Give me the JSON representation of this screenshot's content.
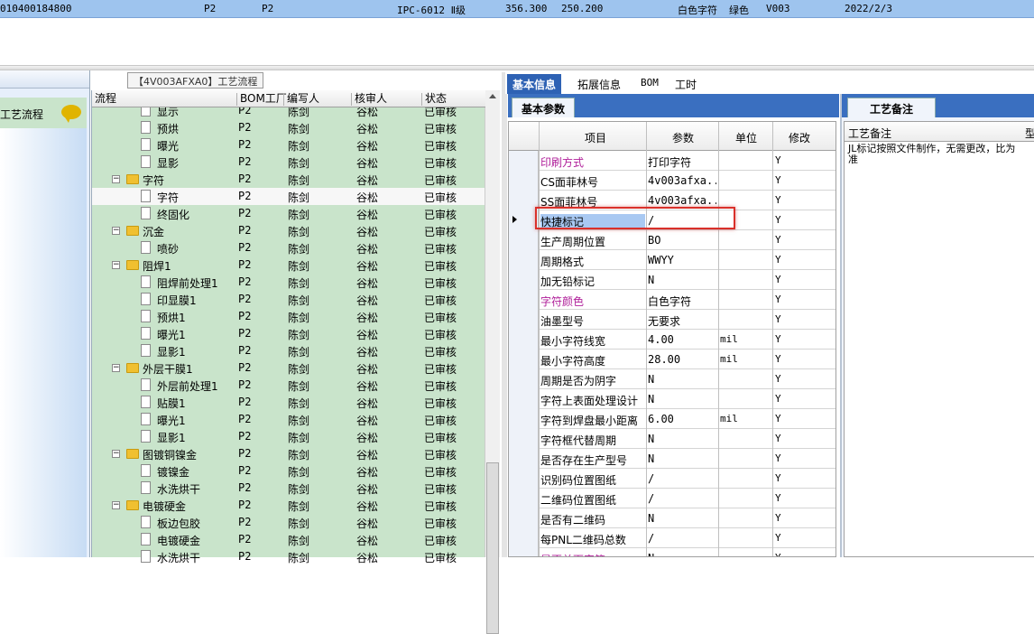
{
  "top_row": {
    "code": "010400184800",
    "col_p2_a": "P2",
    "col_p2_b": "P2",
    "grade": "IPC-6012 Ⅱ级",
    "dim_a": "356.300",
    "dim_b": "250.200",
    "legend_color": "白色字符",
    "mask_color": "绿色",
    "version": "V003",
    "date": "2022/2/3"
  },
  "left_panel": {
    "item_label": "工艺流程"
  },
  "process": {
    "title": "【4V003AFXA0】工艺流程"
  },
  "tree": {
    "columns": [
      "流程",
      "BOM工厂",
      "编写人",
      "核审人",
      "状态"
    ],
    "rows": [
      {
        "name": "显示",
        "level": 2,
        "type": "doc",
        "bom": "P2",
        "writer": "陈剑",
        "reviewer": "谷松",
        "status": "已审核"
      },
      {
        "name": "预烘",
        "level": 2,
        "type": "doc",
        "bom": "P2",
        "writer": "陈剑",
        "reviewer": "谷松",
        "status": "已审核"
      },
      {
        "name": "曝光",
        "level": 2,
        "type": "doc",
        "bom": "P2",
        "writer": "陈剑",
        "reviewer": "谷松",
        "status": "已审核"
      },
      {
        "name": "显影",
        "level": 2,
        "type": "doc",
        "bom": "P2",
        "writer": "陈剑",
        "reviewer": "谷松",
        "status": "已审核"
      },
      {
        "name": "字符",
        "level": 1,
        "type": "folder",
        "bom": "P2",
        "writer": "陈剑",
        "reviewer": "谷松",
        "status": "已审核"
      },
      {
        "name": "字符",
        "level": 2,
        "type": "doc",
        "bom": "P2",
        "writer": "陈剑",
        "reviewer": "谷松",
        "status": "已审核",
        "selected": true
      },
      {
        "name": "终固化",
        "level": 2,
        "type": "doc",
        "bom": "P2",
        "writer": "陈剑",
        "reviewer": "谷松",
        "status": "已审核"
      },
      {
        "name": "沉金",
        "level": 1,
        "type": "folder",
        "bom": "P2",
        "writer": "陈剑",
        "reviewer": "谷松",
        "status": "已审核"
      },
      {
        "name": "喷砂",
        "level": 2,
        "type": "doc",
        "bom": "P2",
        "writer": "陈剑",
        "reviewer": "谷松",
        "status": "已审核"
      },
      {
        "name": "阻焊1",
        "level": 1,
        "type": "folder",
        "bom": "P2",
        "writer": "陈剑",
        "reviewer": "谷松",
        "status": "已审核"
      },
      {
        "name": "阻焊前处理1",
        "level": 2,
        "type": "doc",
        "bom": "P2",
        "writer": "陈剑",
        "reviewer": "谷松",
        "status": "已审核"
      },
      {
        "name": "印显膜1",
        "level": 2,
        "type": "doc",
        "bom": "P2",
        "writer": "陈剑",
        "reviewer": "谷松",
        "status": "已审核"
      },
      {
        "name": "预烘1",
        "level": 2,
        "type": "doc",
        "bom": "P2",
        "writer": "陈剑",
        "reviewer": "谷松",
        "status": "已审核"
      },
      {
        "name": "曝光1",
        "level": 2,
        "type": "doc",
        "bom": "P2",
        "writer": "陈剑",
        "reviewer": "谷松",
        "status": "已审核"
      },
      {
        "name": "显影1",
        "level": 2,
        "type": "doc",
        "bom": "P2",
        "writer": "陈剑",
        "reviewer": "谷松",
        "status": "已审核"
      },
      {
        "name": "外层干膜1",
        "level": 1,
        "type": "folder",
        "bom": "P2",
        "writer": "陈剑",
        "reviewer": "谷松",
        "status": "已审核"
      },
      {
        "name": "外层前处理1",
        "level": 2,
        "type": "doc",
        "bom": "P2",
        "writer": "陈剑",
        "reviewer": "谷松",
        "status": "已审核"
      },
      {
        "name": "贴膜1",
        "level": 2,
        "type": "doc",
        "bom": "P2",
        "writer": "陈剑",
        "reviewer": "谷松",
        "status": "已审核"
      },
      {
        "name": "曝光1",
        "level": 2,
        "type": "doc",
        "bom": "P2",
        "writer": "陈剑",
        "reviewer": "谷松",
        "status": "已审核"
      },
      {
        "name": "显影1",
        "level": 2,
        "type": "doc",
        "bom": "P2",
        "writer": "陈剑",
        "reviewer": "谷松",
        "status": "已审核"
      },
      {
        "name": "图镀铜镍金",
        "level": 1,
        "type": "folder",
        "bom": "P2",
        "writer": "陈剑",
        "reviewer": "谷松",
        "status": "已审核"
      },
      {
        "name": "镀镍金",
        "level": 2,
        "type": "doc",
        "bom": "P2",
        "writer": "陈剑",
        "reviewer": "谷松",
        "status": "已审核"
      },
      {
        "name": "水洗烘干",
        "level": 2,
        "type": "doc",
        "bom": "P2",
        "writer": "陈剑",
        "reviewer": "谷松",
        "status": "已审核"
      },
      {
        "name": "电镀硬金",
        "level": 1,
        "type": "folder",
        "bom": "P2",
        "writer": "陈剑",
        "reviewer": "谷松",
        "status": "已审核"
      },
      {
        "name": "板边包胶",
        "level": 2,
        "type": "doc",
        "bom": "P2",
        "writer": "陈剑",
        "reviewer": "谷松",
        "status": "已审核"
      },
      {
        "name": "电镀硬金",
        "level": 2,
        "type": "doc",
        "bom": "P2",
        "writer": "陈剑",
        "reviewer": "谷松",
        "status": "已审核"
      },
      {
        "name": "水洗烘干",
        "level": 2,
        "type": "doc",
        "bom": "P2",
        "writer": "陈剑",
        "reviewer": "谷松",
        "status": "已审核"
      }
    ]
  },
  "tabs": {
    "items": [
      "基本信息",
      "拓展信息",
      "BOM",
      "工时"
    ],
    "active": 0,
    "sub_tab": "基本参数"
  },
  "params": {
    "columns": [
      "项目",
      "参数",
      "单位",
      "修改"
    ],
    "rows": [
      {
        "name": "印刷方式",
        "value": "打印字符",
        "unit": "",
        "mod": "Y",
        "pink": true
      },
      {
        "name": "CS面菲林号",
        "value": "4v003afxa...",
        "unit": "",
        "mod": "Y"
      },
      {
        "name": "SS面菲林号",
        "value": "4v003afxa...",
        "unit": "",
        "mod": "Y"
      },
      {
        "name": "快捷标记",
        "value": "/",
        "unit": "",
        "mod": "Y",
        "current": true
      },
      {
        "name": "生产周期位置",
        "value": "BO",
        "unit": "",
        "mod": "Y"
      },
      {
        "name": "周期格式",
        "value": "WWYY",
        "unit": "",
        "mod": "Y"
      },
      {
        "name": "加无铅标记",
        "value": "N",
        "unit": "",
        "mod": "Y"
      },
      {
        "name": "字符颜色",
        "value": "白色字符",
        "unit": "",
        "mod": "Y",
        "pink": true
      },
      {
        "name": "油墨型号",
        "value": "无要求",
        "unit": "",
        "mod": "Y"
      },
      {
        "name": "最小字符线宽",
        "value": "4.00",
        "unit": "mil",
        "mod": "Y"
      },
      {
        "name": "最小字符高度",
        "value": "28.00",
        "unit": "mil",
        "mod": "Y"
      },
      {
        "name": "周期是否为阴字",
        "value": "N",
        "unit": "",
        "mod": "Y"
      },
      {
        "name": "字符上表面处理设计",
        "value": "N",
        "unit": "",
        "mod": "Y"
      },
      {
        "name": "字符到焊盘最小距离",
        "value": "6.00",
        "unit": "mil",
        "mod": "Y"
      },
      {
        "name": "字符框代替周期",
        "value": "N",
        "unit": "",
        "mod": "Y"
      },
      {
        "name": "是否存在生产型号",
        "value": "N",
        "unit": "",
        "mod": "Y"
      },
      {
        "name": "识别码位置图纸",
        "value": "/",
        "unit": "",
        "mod": "Y"
      },
      {
        "name": "二维码位置图纸",
        "value": "/",
        "unit": "",
        "mod": "Y"
      },
      {
        "name": "是否有二维码",
        "value": "N",
        "unit": "",
        "mod": "Y"
      },
      {
        "name": "每PNL二维码总数",
        "value": "/",
        "unit": "",
        "mod": "Y"
      },
      {
        "name": "是否单面字符",
        "value": "N",
        "unit": "",
        "mod": "Y",
        "pink": true
      }
    ]
  },
  "notes": {
    "tab": "工艺备注",
    "header": "工艺备注",
    "header2": "型",
    "text": "JL标记按照文件制作，无需更改，比为准"
  },
  "colors": {
    "accent": "#2e62b4",
    "tree_bg": "#c9e4cb",
    "highlight": "#d9302a",
    "pink_text": "#b0209a"
  }
}
